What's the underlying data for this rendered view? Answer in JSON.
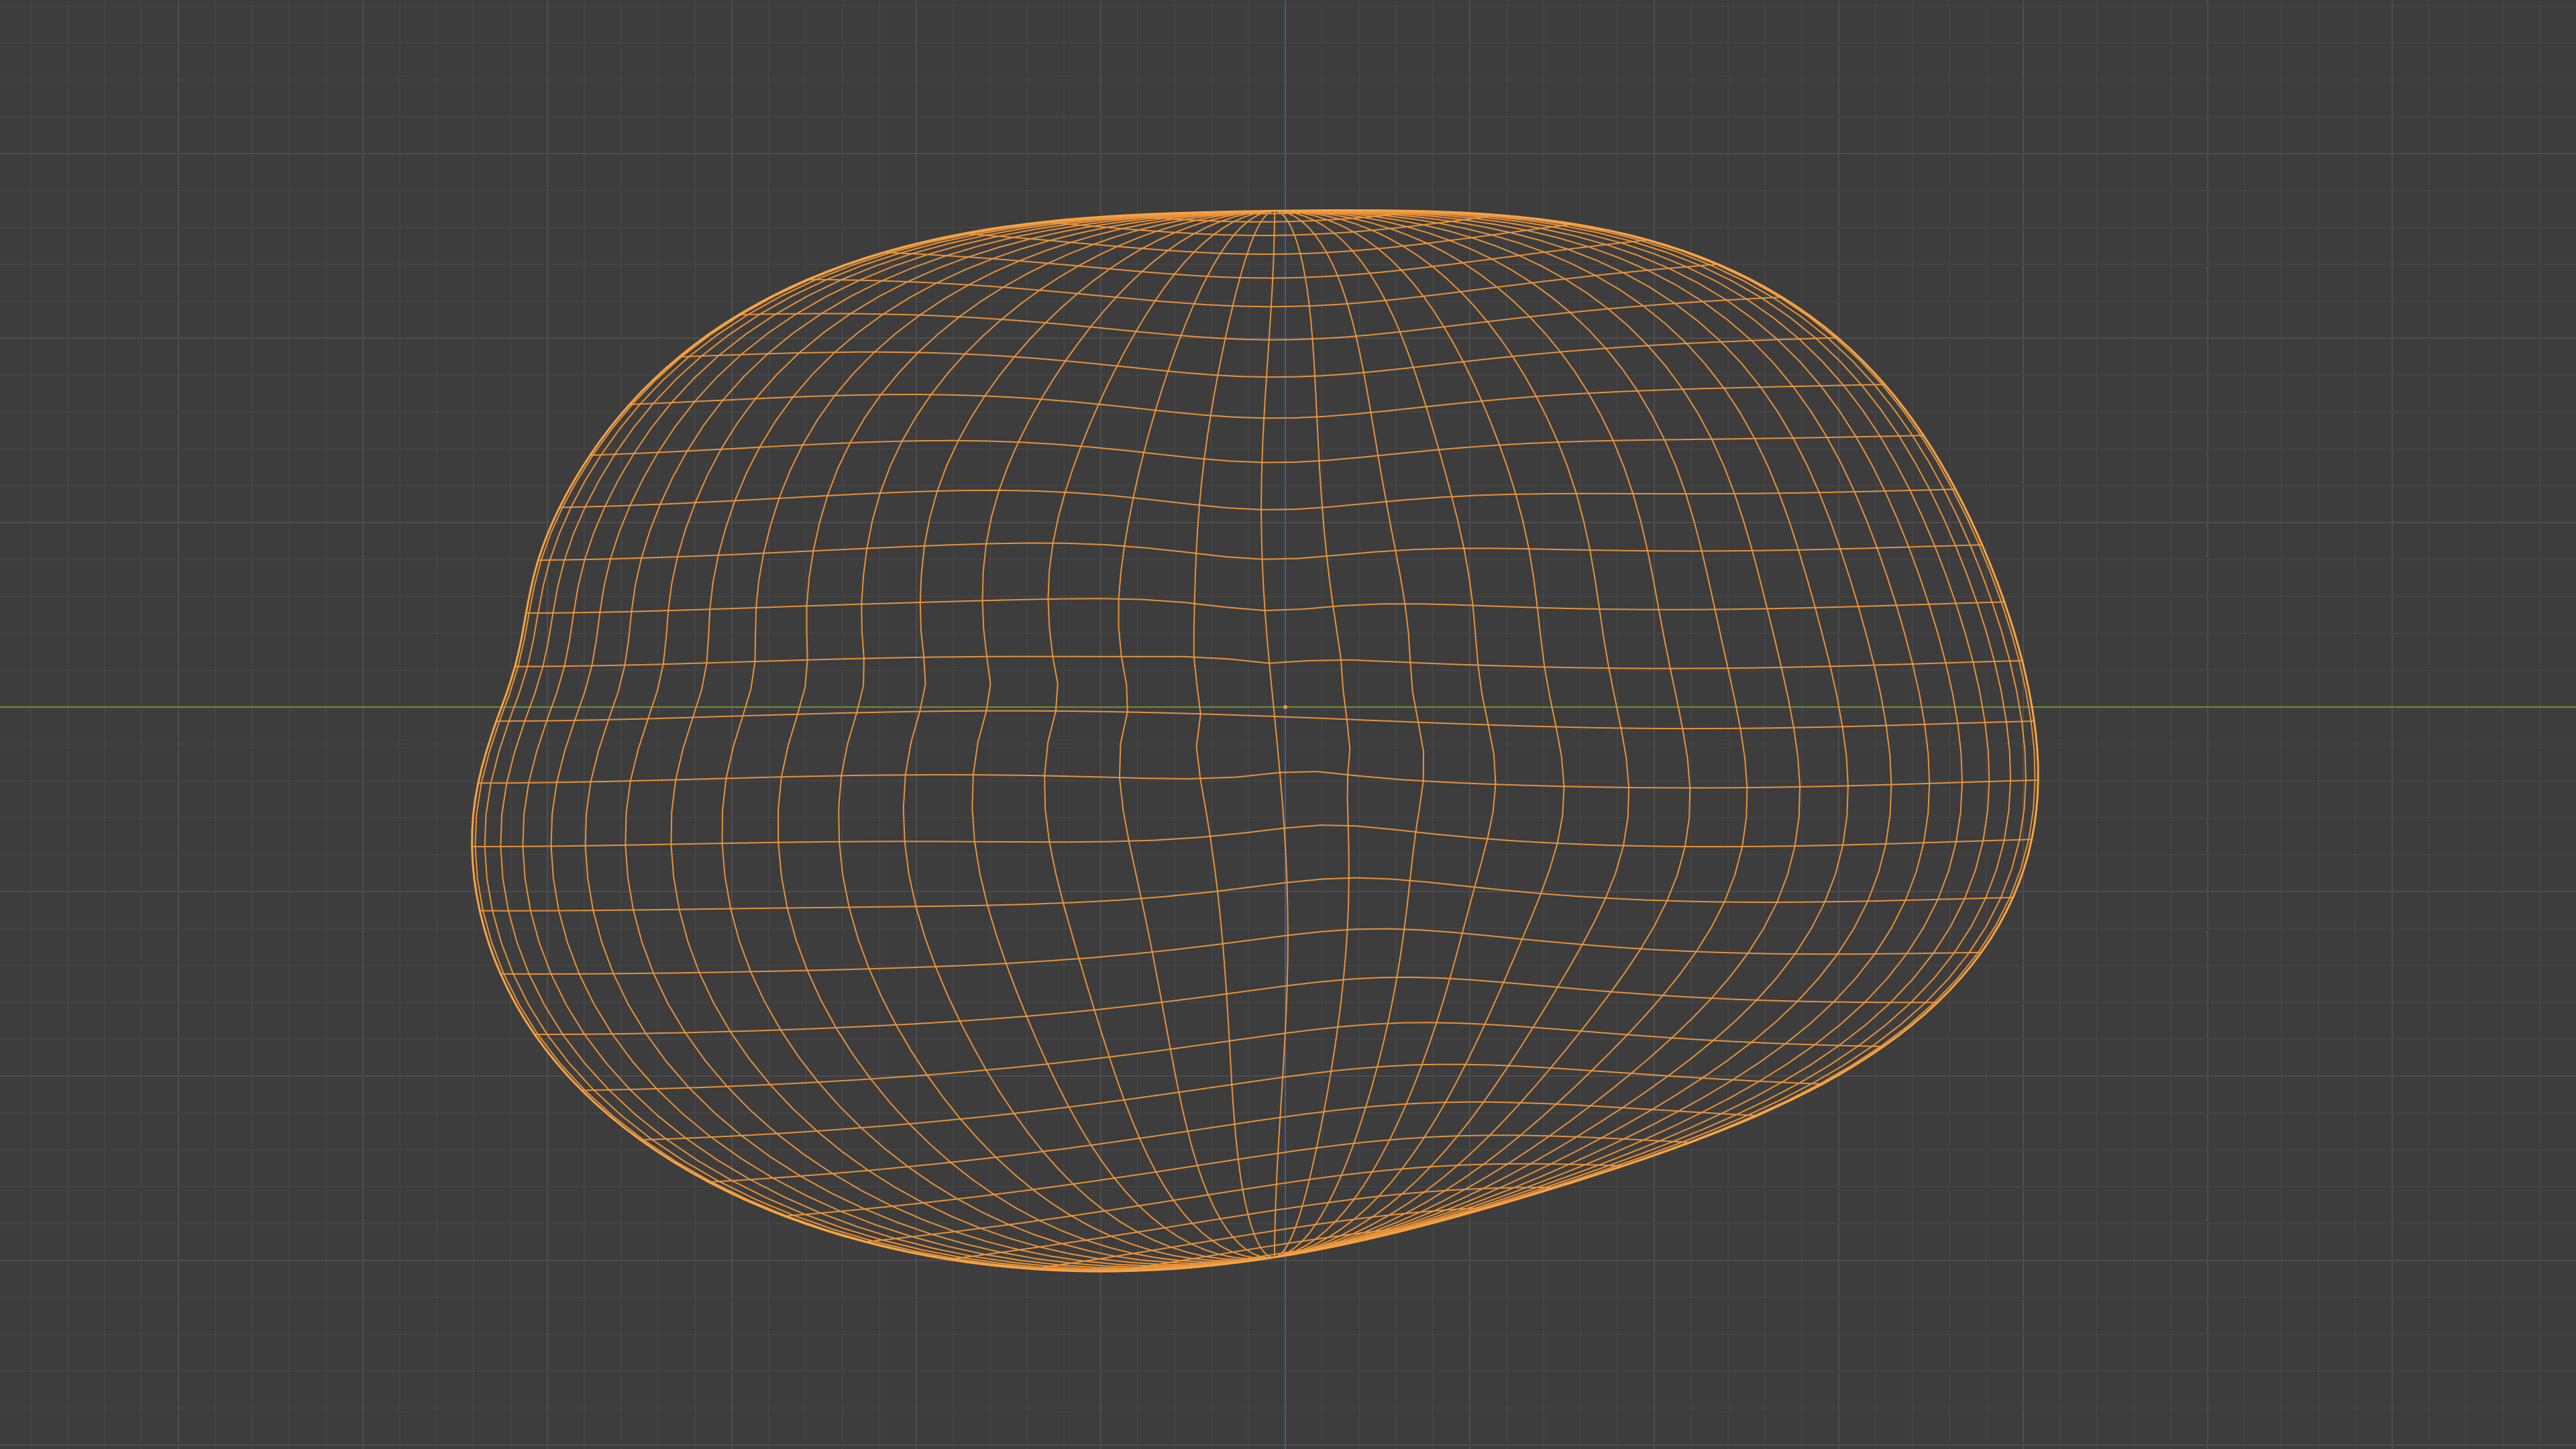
{
  "viewport": {
    "view": "3d-viewport",
    "display_mode": "wireframe",
    "object": {
      "type": "mesh",
      "selected": true,
      "shape": "irregular-blob"
    }
  },
  "colors": {
    "background": "#3d3d3d",
    "grid_minor": "#474747",
    "grid_major": "#4e4e4e",
    "x_axis": "#6f8f39",
    "z_axis": "#3e5f96",
    "wire_selected": "#f0973a",
    "wire_outline": "#f7a544",
    "origin_dot": "#f29a3c"
  }
}
